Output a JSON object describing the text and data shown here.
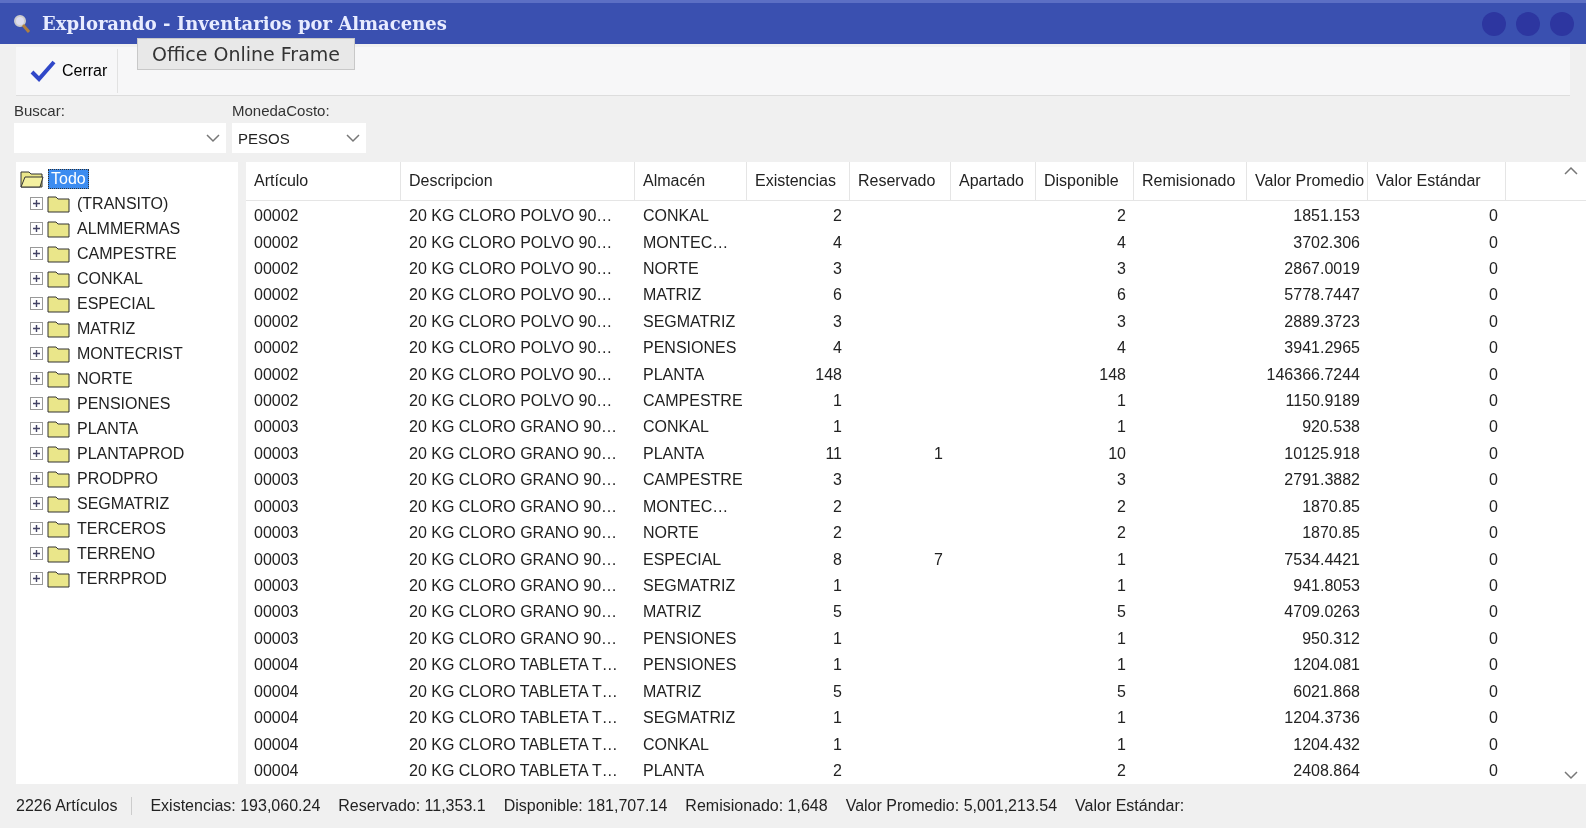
{
  "window": {
    "title": "Explorando - Inventarios por Almacenes"
  },
  "toolbar": {
    "close_button": "Cerrar",
    "tooltip": "Office Online Frame"
  },
  "filters": [
    {
      "label": "Buscar:"
    },
    {
      "label": "MonedaCosto:",
      "value": "PESOS"
    }
  ],
  "tree": {
    "root": {
      "label": "Todo",
      "selected": true,
      "children": [
        {
          "label": "(TRANSITO)",
          "expanded": false
        },
        {
          "label": "ALMMERMAS",
          "expanded": false
        },
        {
          "label": "CAMPESTRE",
          "expanded": false
        },
        {
          "label": "CONKAL",
          "expanded": false
        },
        {
          "label": "ESPECIAL",
          "expanded": false
        },
        {
          "label": "MATRIZ",
          "expanded": false
        },
        {
          "label": "MONTECRIST",
          "expanded": false
        },
        {
          "label": "NORTE",
          "expanded": false
        },
        {
          "label": "PENSIONES",
          "expanded": false
        },
        {
          "label": "PLANTA",
          "expanded": false
        },
        {
          "label": "PLANTAPROD",
          "expanded": false
        },
        {
          "label": "PRODPRO",
          "expanded": false
        },
        {
          "label": "SEGMATRIZ",
          "expanded": false
        },
        {
          "label": "TERCEROS",
          "expanded": false
        },
        {
          "label": "TERRENO",
          "expanded": false
        },
        {
          "label": "TERRPROD",
          "expanded": false
        }
      ]
    }
  },
  "table": {
    "columns": [
      "Artículo",
      "Descripcion",
      "Almacén",
      "Existencias",
      "Reservado",
      "Apartado",
      "Disponible",
      "Remisionado",
      "Valor Promedio",
      "Valor Estándar"
    ],
    "rows": [
      [
        "00002",
        "20 KG CLORO POLVO 90…",
        "CONKAL",
        "2",
        null,
        null,
        "2",
        null,
        "1851.153",
        "0"
      ],
      [
        "00002",
        "20 KG CLORO POLVO 90…",
        "MONTEC…",
        "4",
        null,
        null,
        "4",
        null,
        "3702.306",
        "0"
      ],
      [
        "00002",
        "20 KG CLORO POLVO 90…",
        "NORTE",
        "3",
        null,
        null,
        "3",
        null,
        "2867.0019",
        "0"
      ],
      [
        "00002",
        "20 KG CLORO POLVO 90…",
        "MATRIZ",
        "6",
        null,
        null,
        "6",
        null,
        "5778.7447",
        "0"
      ],
      [
        "00002",
        "20 KG CLORO POLVO 90…",
        "SEGMATRIZ",
        "3",
        null,
        null,
        "3",
        null,
        "2889.3723",
        "0"
      ],
      [
        "00002",
        "20 KG CLORO POLVO 90…",
        "PENSIONES",
        "4",
        null,
        null,
        "4",
        null,
        "3941.2965",
        "0"
      ],
      [
        "00002",
        "20 KG CLORO POLVO 90…",
        "PLANTA",
        "148",
        null,
        null,
        "148",
        null,
        "146366.7244",
        "0"
      ],
      [
        "00002",
        "20 KG CLORO POLVO 90…",
        "CAMPESTRE",
        "1",
        null,
        null,
        "1",
        null,
        "1150.9189",
        "0"
      ],
      [
        "00003",
        "20 KG CLORO GRANO 90…",
        "CONKAL",
        "1",
        null,
        null,
        "1",
        null,
        "920.538",
        "0"
      ],
      [
        "00003",
        "20 KG CLORO GRANO 90…",
        "PLANTA",
        "11",
        "1",
        null,
        "10",
        null,
        "10125.918",
        "0"
      ],
      [
        "00003",
        "20 KG CLORO GRANO 90…",
        "CAMPESTRE",
        "3",
        null,
        null,
        "3",
        null,
        "2791.3882",
        "0"
      ],
      [
        "00003",
        "20 KG CLORO GRANO 90…",
        "MONTEC…",
        "2",
        null,
        null,
        "2",
        null,
        "1870.85",
        "0"
      ],
      [
        "00003",
        "20 KG CLORO GRANO 90…",
        "NORTE",
        "2",
        null,
        null,
        "2",
        null,
        "1870.85",
        "0"
      ],
      [
        "00003",
        "20 KG CLORO GRANO 90…",
        "ESPECIAL",
        "8",
        "7",
        null,
        "1",
        null,
        "7534.4421",
        "0"
      ],
      [
        "00003",
        "20 KG CLORO GRANO 90…",
        "SEGMATRIZ",
        "1",
        null,
        null,
        "1",
        null,
        "941.8053",
        "0"
      ],
      [
        "00003",
        "20 KG CLORO GRANO 90…",
        "MATRIZ",
        "5",
        null,
        null,
        "5",
        null,
        "4709.0263",
        "0"
      ],
      [
        "00003",
        "20 KG CLORO GRANO 90…",
        "PENSIONES",
        "1",
        null,
        null,
        "1",
        null,
        "950.312",
        "0"
      ],
      [
        "00004",
        "20 KG CLORO TABLETA T…",
        "PENSIONES",
        "1",
        null,
        null,
        "1",
        null,
        "1204.081",
        "0"
      ],
      [
        "00004",
        "20 KG CLORO TABLETA T…",
        "MATRIZ",
        "5",
        null,
        null,
        "5",
        null,
        "6021.868",
        "0"
      ],
      [
        "00004",
        "20 KG CLORO TABLETA T…",
        "SEGMATRIZ",
        "1",
        null,
        null,
        "1",
        null,
        "1204.3736",
        "0"
      ],
      [
        "00004",
        "20 KG CLORO TABLETA T…",
        "CONKAL",
        "1",
        null,
        null,
        "1",
        null,
        "1204.432",
        "0"
      ],
      [
        "00004",
        "20 KG CLORO TABLETA T…",
        "PLANTA",
        "2",
        null,
        null,
        "2",
        null,
        "2408.864",
        "0"
      ]
    ]
  },
  "status_bar": [
    "2226 Artículos",
    "Existencias: 193,060.24",
    "Reservado: 11,353.1",
    "Disponible: 181,707.14",
    "Remisionado: 1,648",
    "Valor Promedio: 5,001,213.54",
    "Valor Estándar:"
  ]
}
